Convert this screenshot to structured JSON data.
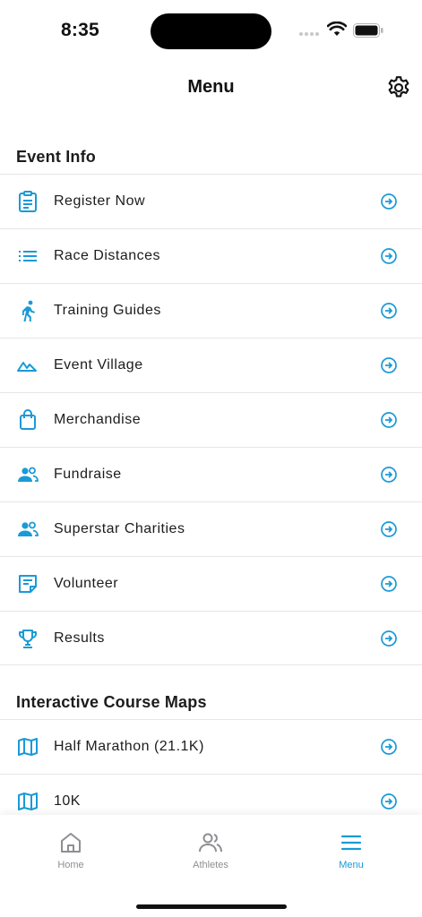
{
  "status": {
    "time": "8:35"
  },
  "nav": {
    "title": "Menu"
  },
  "colors": {
    "accent": "#1a9ad6",
    "inactive": "#8e8e93"
  },
  "sections": [
    {
      "title": "Event Info",
      "items": [
        {
          "label": "Register Now",
          "icon": "clipboard-icon"
        },
        {
          "label": "Race Distances",
          "icon": "list-icon"
        },
        {
          "label": "Training Guides",
          "icon": "runner-icon"
        },
        {
          "label": "Event Village",
          "icon": "landscape-icon"
        },
        {
          "label": "Merchandise",
          "icon": "shopping-bag-icon"
        },
        {
          "label": "Fundraise",
          "icon": "people-icon"
        },
        {
          "label": "Superstar Charities",
          "icon": "people-icon"
        },
        {
          "label": "Volunteer",
          "icon": "note-icon"
        },
        {
          "label": "Results",
          "icon": "trophy-icon"
        }
      ]
    },
    {
      "title": "Interactive Course Maps",
      "items": [
        {
          "label": "Half Marathon (21.1K)",
          "icon": "map-icon"
        },
        {
          "label": "10K",
          "icon": "map-icon"
        }
      ]
    }
  ],
  "tabs": [
    {
      "label": "Home",
      "icon": "home-icon",
      "active": false
    },
    {
      "label": "Athletes",
      "icon": "people-outline-icon",
      "active": false
    },
    {
      "label": "Menu",
      "icon": "hamburger-icon",
      "active": true
    }
  ]
}
